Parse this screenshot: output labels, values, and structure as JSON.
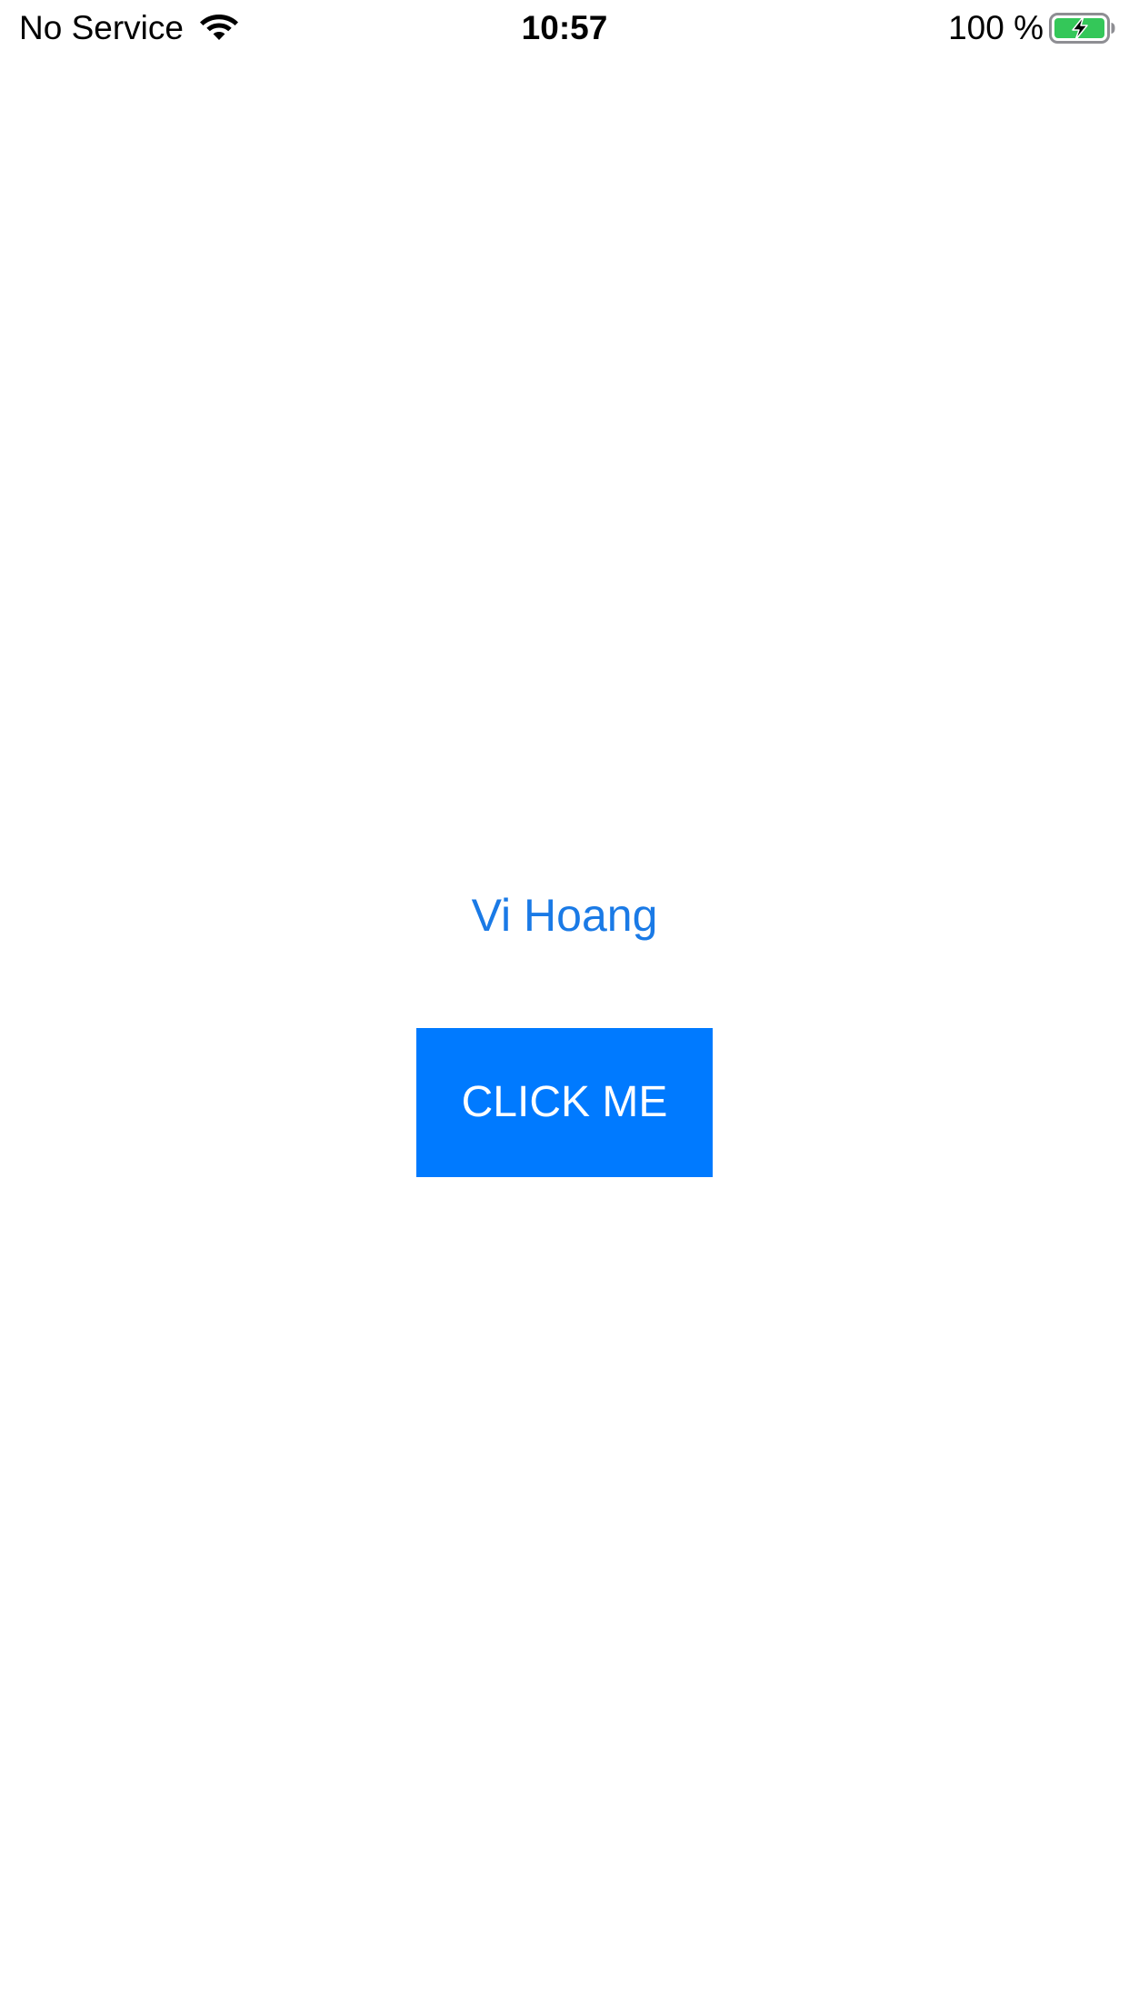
{
  "status_bar": {
    "carrier": "No Service",
    "time": "10:57",
    "battery_percent": "100 %",
    "wifi_icon": "wifi-icon",
    "battery_icon": "battery-charging-icon",
    "battery_color": "#34c759"
  },
  "main": {
    "name_label": "Vi Hoang",
    "button_label": "CLICK ME",
    "accent_color": "#007aff"
  }
}
